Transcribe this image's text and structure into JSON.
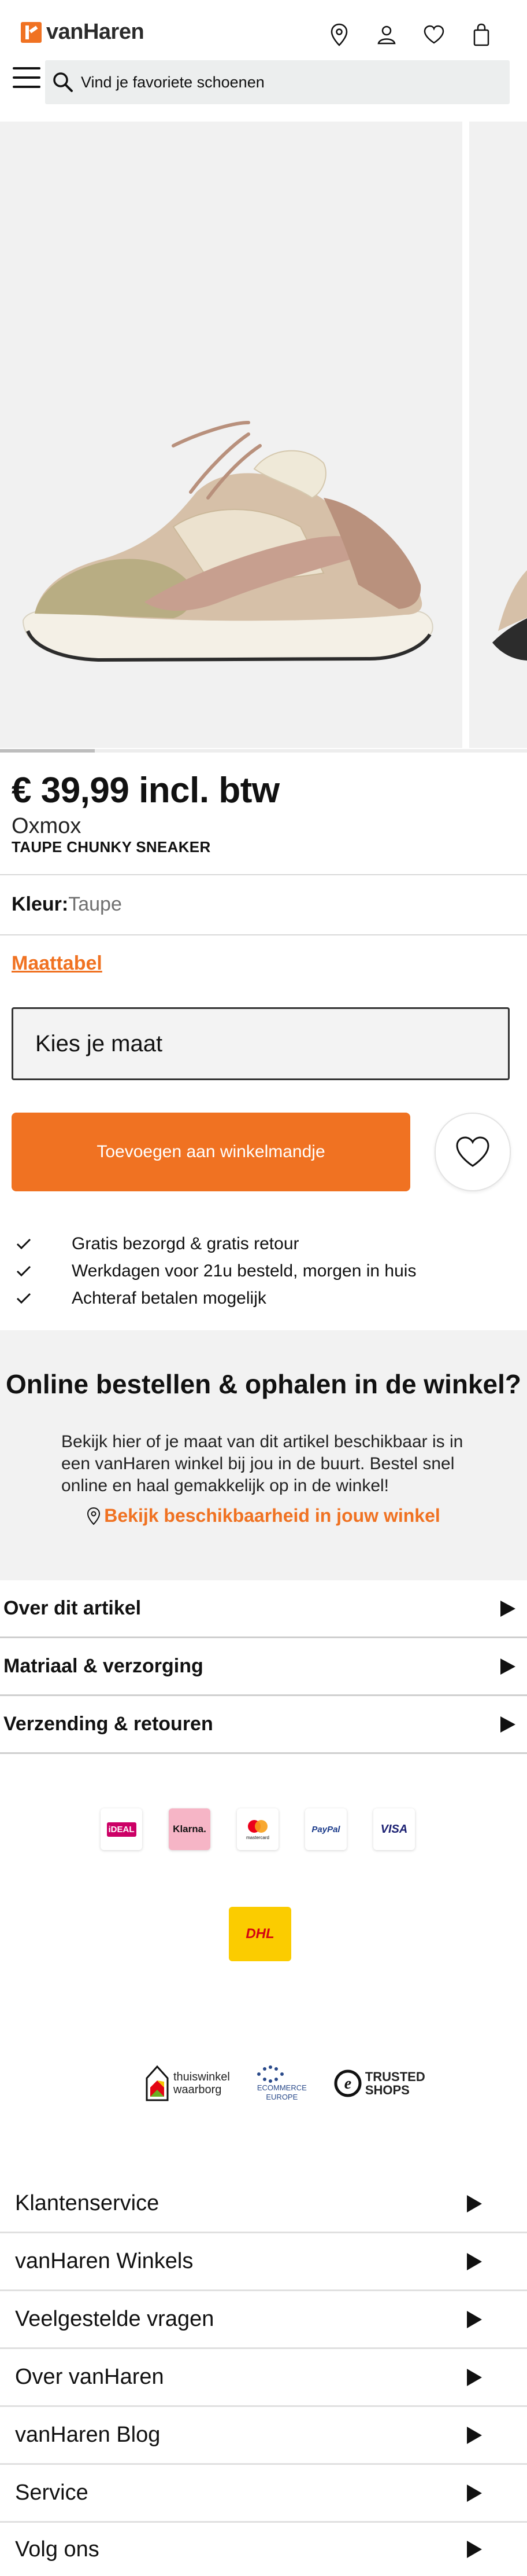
{
  "brand_name": "vanHaren",
  "header": {
    "icons": [
      "location-icon",
      "account-icon",
      "wishlist-icon",
      "cart-icon"
    ],
    "search_placeholder": "Vind je favoriete schoenen"
  },
  "gallery": {
    "progress": 0.18
  },
  "product": {
    "price": "€ 39,99 incl. btw",
    "brand": "Oxmox",
    "name": "TAUPE CHUNKY SNEAKER",
    "color_label": "Kleur:",
    "color_value": "Taupe",
    "size_chart": "Maattabel",
    "size_placeholder": "Kies je maat",
    "add_to_cart": "Toevoegen aan winkelmandje"
  },
  "usps": [
    "Gratis bezorgd & gratis retour",
    "Werkdagen voor 21u besteld, morgen in huis",
    "Achteraf betalen mogelijk"
  ],
  "store": {
    "title": "Online bestellen & ophalen in de winkel?",
    "text": "Bekijk hier of je maat van dit artikel beschikbaar is in een vanHaren winkel bij jou in de buurt. Bestel snel online en haal gemakkelijk op in de winkel!",
    "link": "Bekijk beschikbaarheid in jouw winkel"
  },
  "accordions": [
    "Over dit artikel",
    "Matriaal & verzorging",
    "Verzending & retouren"
  ],
  "payments": [
    "iDEAL",
    "Klarna.",
    "mastercard",
    "PayPal",
    "VISA"
  ],
  "shipping": "DHL",
  "trust": {
    "thuiswinkel": [
      "thuiswinkel",
      "waarborg"
    ],
    "ecommerce": [
      "ECOMMERCE",
      "EUROPE"
    ],
    "trusted": [
      "TRUSTED",
      "SHOPS"
    ]
  },
  "colors": {
    "accent": "#f07222",
    "klarna": "#f6b5c6",
    "dhl": "#fbcc00"
  },
  "footer_links": [
    "Klantenservice",
    "vanHaren Winkels",
    "Veelgestelde vragen",
    "Over vanHaren",
    "vanHaren Blog",
    "Service",
    "Volg ons"
  ]
}
